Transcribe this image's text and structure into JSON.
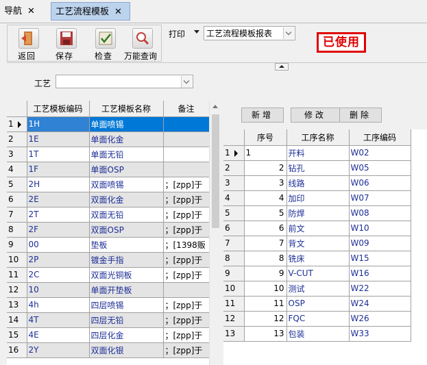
{
  "tabs": [
    {
      "label": "导航"
    },
    {
      "label": "工艺流程模板"
    }
  ],
  "close_glyph": "✕",
  "toolbar": {
    "buttons": [
      {
        "label": "返回",
        "icon": "exit-door-icon"
      },
      {
        "label": "保存",
        "icon": "floppy-save-icon"
      },
      {
        "label": "检查",
        "icon": "check-icon"
      },
      {
        "label": "万能查询",
        "icon": "search-query-icon"
      }
    ],
    "print_label": "打印",
    "report_value": "工艺流程模板报表"
  },
  "stamp": "已使用",
  "filter": {
    "craft_label": "工艺",
    "craft_value": ""
  },
  "left_table": {
    "columns": [
      "工艺模板编码",
      "工艺模板名称",
      "备注"
    ],
    "rows": [
      {
        "n": "1",
        "code": "1H",
        "name": "单面喷锡",
        "note": ""
      },
      {
        "n": "2",
        "code": "1E",
        "name": "单面化金",
        "note": ""
      },
      {
        "n": "3",
        "code": "1T",
        "name": "单面无铅",
        "note": ""
      },
      {
        "n": "4",
        "code": "1F",
        "name": "单面OSP",
        "note": ""
      },
      {
        "n": "5",
        "code": "2H",
        "name": "双面喷锡",
        "note": "；[zpp]于"
      },
      {
        "n": "6",
        "code": "2E",
        "name": "双面化金",
        "note": "；[zpp]于"
      },
      {
        "n": "7",
        "code": "2T",
        "name": "双面无铅",
        "note": "；[zpp]于"
      },
      {
        "n": "8",
        "code": "2F",
        "name": "双面OSP",
        "note": "；[zpp]于"
      },
      {
        "n": "9",
        "code": "00",
        "name": "垫板",
        "note": "；[1398贩"
      },
      {
        "n": "10",
        "code": "2P",
        "name": "镀金手指",
        "note": "；[zpp]于"
      },
      {
        "n": "11",
        "code": "2C",
        "name": "双面光铜板",
        "note": "；[zpp]于"
      },
      {
        "n": "12",
        "code": "10",
        "name": "单面开垫板",
        "note": ""
      },
      {
        "n": "13",
        "code": "4h",
        "name": "四层喷锡",
        "note": "；[zpp]于"
      },
      {
        "n": "14",
        "code": "4T",
        "name": "四层无铅",
        "note": "；[zpp]于"
      },
      {
        "n": "15",
        "code": "4E",
        "name": "四层化金",
        "note": "；[zpp]于"
      },
      {
        "n": "16",
        "code": "2Y",
        "name": "双面化银",
        "note": "；[zpp]于"
      }
    ]
  },
  "actions": {
    "add": "新增",
    "edit": "修改",
    "delete": "删除"
  },
  "right_table": {
    "columns": [
      "序号",
      "工序名称",
      "工序编码"
    ],
    "rows": [
      {
        "n": "1",
        "seq": "1",
        "name": "开料",
        "code": "W02"
      },
      {
        "n": "2",
        "seq": "2",
        "name": "钻孔",
        "code": "W05"
      },
      {
        "n": "3",
        "seq": "3",
        "name": "线路",
        "code": "W06"
      },
      {
        "n": "4",
        "seq": "4",
        "name": "加印",
        "code": "W07"
      },
      {
        "n": "5",
        "seq": "5",
        "name": "防焊",
        "code": "W08"
      },
      {
        "n": "6",
        "seq": "6",
        "name": "前文",
        "code": "W10"
      },
      {
        "n": "7",
        "seq": "7",
        "name": "背文",
        "code": "W09"
      },
      {
        "n": "8",
        "seq": "8",
        "name": "铣床",
        "code": "W15"
      },
      {
        "n": "9",
        "seq": "9",
        "name": "V-CUT",
        "code": "W16"
      },
      {
        "n": "10",
        "seq": "10",
        "name": "测试",
        "code": "W22"
      },
      {
        "n": "11",
        "seq": "11",
        "name": "OSP",
        "code": "W24"
      },
      {
        "n": "12",
        "seq": "12",
        "name": "FQC",
        "code": "W26"
      },
      {
        "n": "13",
        "seq": "13",
        "name": "包装",
        "code": "W33"
      }
    ]
  },
  "colors": {
    "selection": "#0078d7",
    "stamp": "#e00000",
    "link_text": "#1c2e96",
    "active_tab": "#bcd3ee"
  }
}
